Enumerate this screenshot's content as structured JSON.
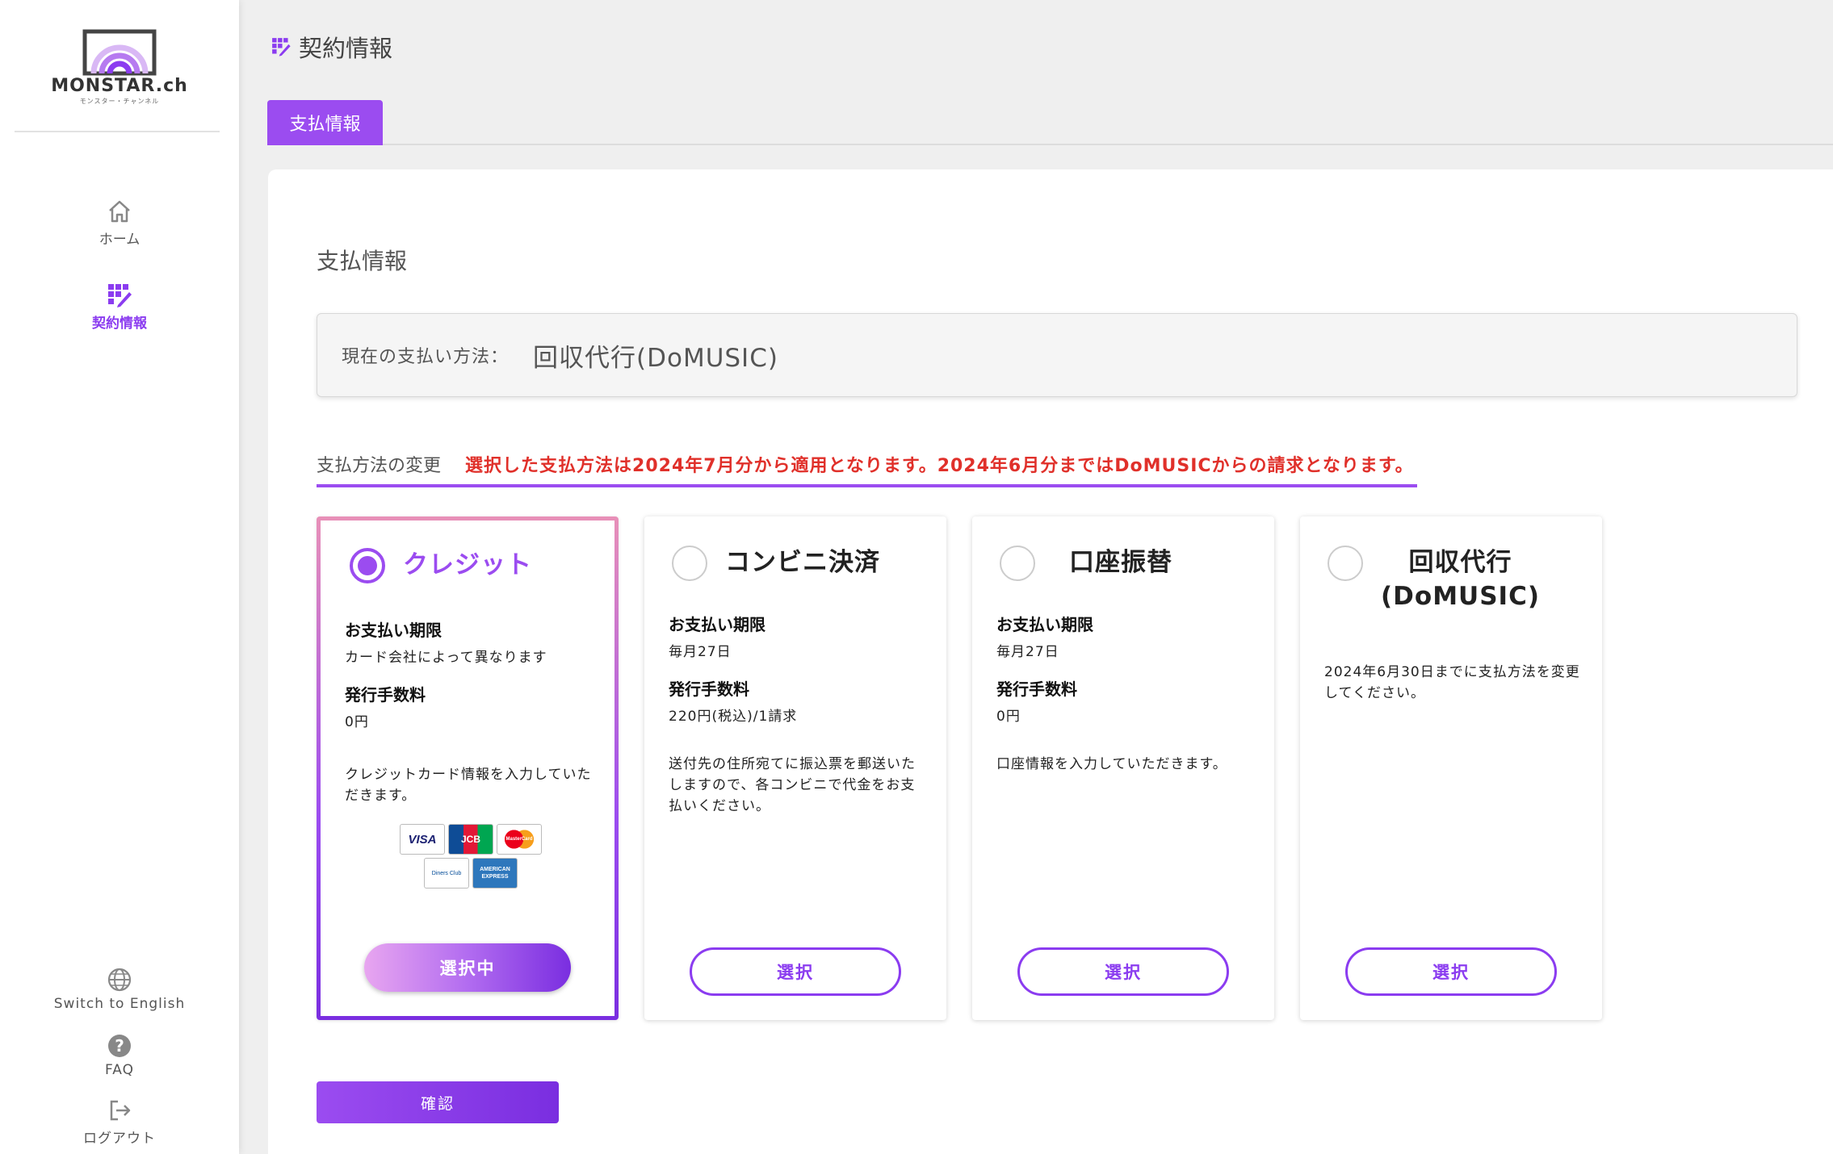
{
  "brand": {
    "name": "MONSTAR.ch",
    "sub": "モンスター・チャンネル",
    "accent": "#9b4cf0",
    "alert": "#e0302a"
  },
  "sidebar": {
    "items": [
      {
        "label": "ホーム",
        "icon": "home-icon"
      },
      {
        "label": "契約情報",
        "icon": "contract-icon",
        "active": true
      }
    ],
    "bottom": [
      {
        "label": "Switch to English",
        "icon": "globe-icon"
      },
      {
        "label": "FAQ",
        "icon": "help-icon"
      },
      {
        "label": "ログアウト",
        "icon": "logout-icon"
      }
    ]
  },
  "header": {
    "title": "契約情報"
  },
  "tabs": [
    {
      "label": "支払情報",
      "active": true
    }
  ],
  "main": {
    "section_title": "支払情報",
    "current_label": "現在の支払い方法：",
    "current_value": "回収代行(DoMUSIC)",
    "change_label": "支払方法の変更",
    "change_note": "選択した支払方法は2024年7月分から適用となります。2024年6月分まではDoMUSICからの請求となります。",
    "confirm_label": "確認"
  },
  "cards": [
    {
      "title": "クレジット",
      "selected": true,
      "deadline_head": "お支払い期限",
      "deadline_val": "カード会社によって異なります",
      "fee_head": "発行手数料",
      "fee_val": "0円",
      "desc": "クレジットカード情報を入力していただきます。",
      "brands": [
        "VISA",
        "JCB",
        "MasterCard",
        "Diners Club",
        "AMERICAN EXPRESS"
      ],
      "button": "選択中"
    },
    {
      "title": "コンビニ決済",
      "selected": false,
      "deadline_head": "お支払い期限",
      "deadline_val": "毎月27日",
      "fee_head": "発行手数料",
      "fee_val": "220円(税込)/1請求",
      "desc": "送付先の住所宛てに振込票を郵送いたしますので、各コンビニで代金をお支払いください。",
      "button": "選択"
    },
    {
      "title": "口座振替",
      "selected": false,
      "deadline_head": "お支払い期限",
      "deadline_val": "毎月27日",
      "fee_head": "発行手数料",
      "fee_val": "0円",
      "desc": "口座情報を入力していただきます。",
      "button": "選択"
    },
    {
      "title_line1": "回収代行",
      "title_line2": "(DoMUSIC)",
      "selected": false,
      "desc": "2024年6月30日までに支払方法を変更してください。",
      "button": "選択"
    }
  ]
}
